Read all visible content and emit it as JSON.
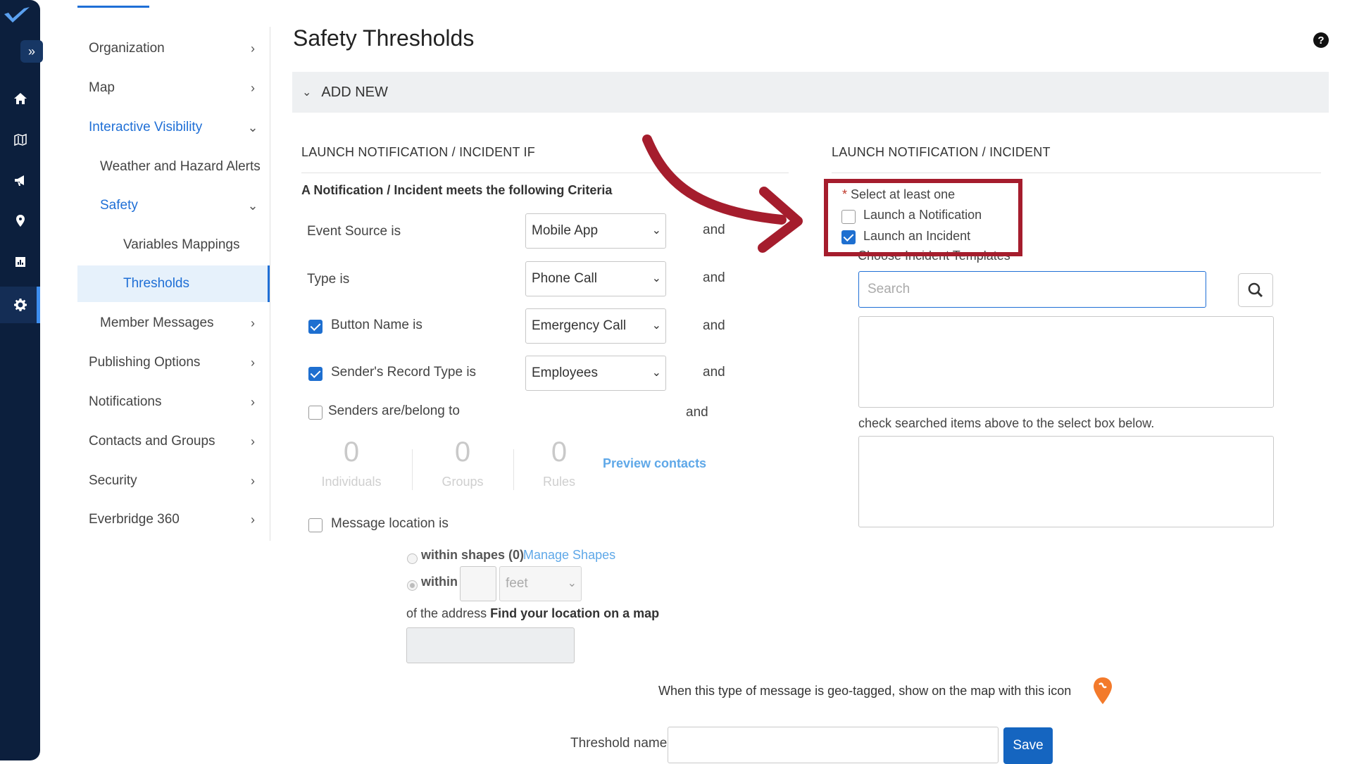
{
  "nav": {
    "items": [
      {
        "label": "Organization"
      },
      {
        "label": "Map"
      },
      {
        "label": "Interactive Visibility"
      },
      {
        "label": "Weather and Hazard Alerts"
      },
      {
        "label": "Safety"
      },
      {
        "label": "Variables Mappings"
      },
      {
        "label": "Thresholds"
      },
      {
        "label": "Member Messages"
      },
      {
        "label": "Publishing Options"
      },
      {
        "label": "Notifications"
      },
      {
        "label": "Contacts and Groups"
      },
      {
        "label": "Security"
      },
      {
        "label": "Everbridge 360"
      }
    ]
  },
  "header": {
    "title": "Safety Thresholds",
    "help": "?"
  },
  "add_new": {
    "label": "ADD NEW"
  },
  "left_section": {
    "title": "LAUNCH NOTIFICATION / INCIDENT IF",
    "criteria": "A Notification / Incident meets the following Criteria",
    "event_source": {
      "label": "Event Source is",
      "value": "Mobile App"
    },
    "type": {
      "label": "Type is",
      "value": "Phone Call"
    },
    "button_name": {
      "label": "Button Name is",
      "value": "Emergency Call",
      "checked": true
    },
    "sender_record": {
      "label": "Sender's Record Type is",
      "value": "Employees",
      "checked": true
    },
    "senders": {
      "label": "Senders are/belong to",
      "checked": false
    },
    "and": "and",
    "counts": [
      {
        "value": "0",
        "label": "Individuals"
      },
      {
        "value": "0",
        "label": "Groups"
      },
      {
        "value": "0",
        "label": "Rules"
      }
    ],
    "preview_contacts": "Preview contacts",
    "message_location": {
      "label": "Message location is",
      "checked": false
    },
    "within_shapes": "within shapes (0)",
    "manage_shapes": "Manage Shapes",
    "within": "within",
    "unit": "feet",
    "of_the_address": "of the address",
    "find_location": "Find your location on a map"
  },
  "right_section": {
    "title": "LAUNCH NOTIFICATION / INCIDENT",
    "required_asterisk": "*",
    "select_hint": "Select at least one",
    "launch_notification": {
      "label": "Launch a Notification",
      "checked": false
    },
    "launch_incident": {
      "label": "Launch an Incident",
      "checked": true
    },
    "choose_templates": "Choose Incident Templates",
    "search_placeholder": "Search",
    "check_hint": "check searched items above to the select box below."
  },
  "geo_tag_text": "When this type of message is geo-tagged, show on the map with this icon",
  "threshold_name": {
    "label": "Threshold name",
    "value": ""
  },
  "save": "Save",
  "colors": {
    "accent": "#1f6fd6",
    "annotation": "#a51d2d",
    "rail": "#0c1f3d",
    "pin": "#f37a2b"
  }
}
